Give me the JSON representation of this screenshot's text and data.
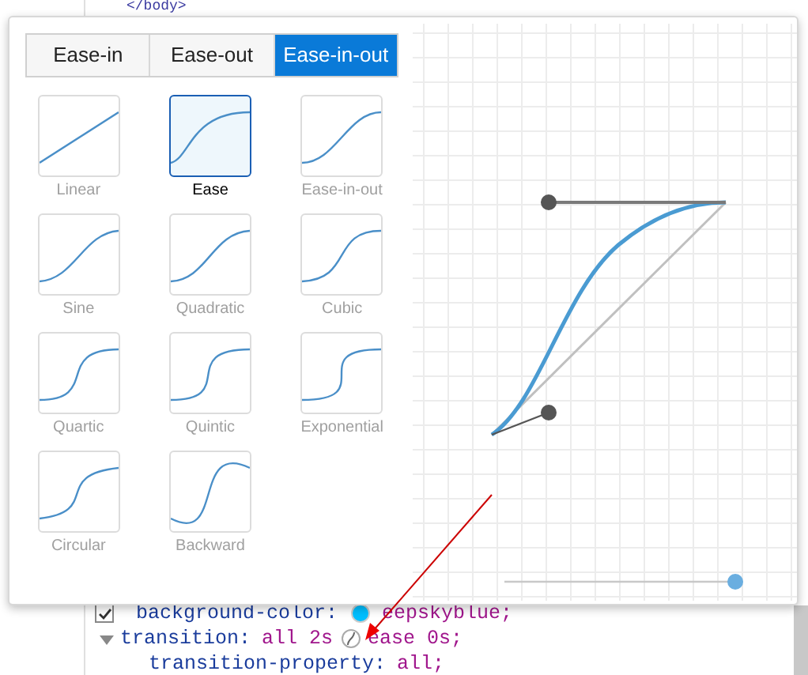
{
  "source_top": {
    "text": "</body>"
  },
  "popup": {
    "tabs": [
      {
        "label": "Ease-in",
        "selected": false
      },
      {
        "label": "Ease-out",
        "selected": false
      },
      {
        "label": "Ease-in-out",
        "selected": true
      }
    ],
    "presets": [
      {
        "label": "Linear",
        "kind": "linear",
        "selected": false
      },
      {
        "label": "Ease",
        "kind": "ease",
        "selected": true
      },
      {
        "label": "Ease-in-out",
        "kind": "ease-in-out",
        "selected": false
      },
      {
        "label": "Sine",
        "kind": "sine",
        "selected": false
      },
      {
        "label": "Quadratic",
        "kind": "quad",
        "selected": false
      },
      {
        "label": "Cubic",
        "kind": "cubic",
        "selected": false
      },
      {
        "label": "Quartic",
        "kind": "quart",
        "selected": false
      },
      {
        "label": "Quintic",
        "kind": "quint",
        "selected": false
      },
      {
        "label": "Exponential",
        "kind": "expo",
        "selected": false
      },
      {
        "label": "Circular",
        "kind": "circ",
        "selected": false
      },
      {
        "label": "Backward",
        "kind": "back",
        "selected": false
      }
    ],
    "preview_slider": {
      "level": 0.98
    }
  },
  "css_lines": [
    {
      "kind": "checkbox",
      "checked": true,
      "property": "background-color:",
      "value": "eepskyblue;"
    },
    {
      "kind": "expander",
      "expanded": true,
      "property": "transition:",
      "value": "all 2s",
      "value_after": "ease 0s;"
    },
    {
      "kind": "plain",
      "property": "transition-property:",
      "value": "all;"
    }
  ]
}
